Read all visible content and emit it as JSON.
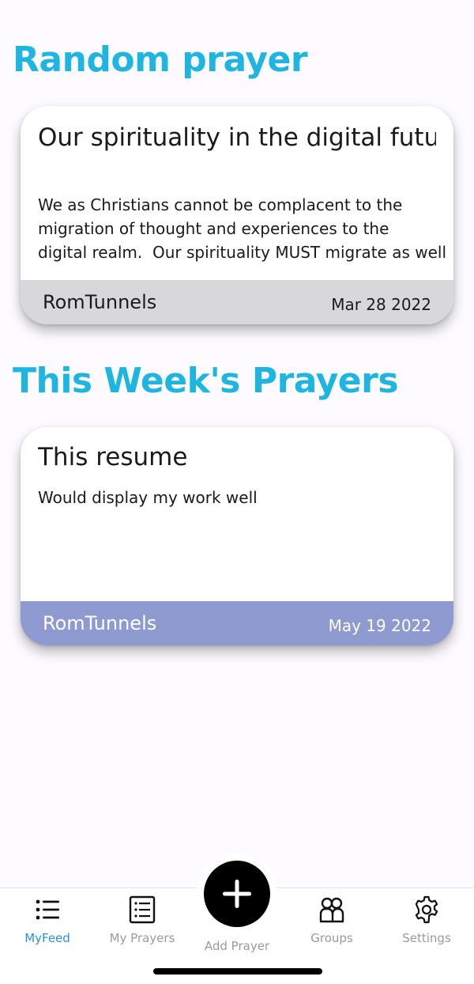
{
  "sections": {
    "random_title": "Random prayer",
    "week_title": "This Week's Prayers"
  },
  "random_card": {
    "title": "Our spirituality in the digital future",
    "body": "We as Christians cannot be complacent to the\nmigration of thought and experiences to the\ndigital realm.  Our spirituality MUST migrate as well",
    "author": "RomTunnels",
    "date": "Mar 28 2022",
    "footer_color": "#d8d8da"
  },
  "week_cards": [
    {
      "title": "This resume",
      "body": "Would display my work well",
      "author": "RomTunnels",
      "date": "May 19 2022",
      "footer_color": "#8e9ad0"
    }
  ],
  "nav": {
    "items": [
      {
        "label": "MyFeed",
        "icon": "list-icon",
        "active": true
      },
      {
        "label": "My Prayers",
        "icon": "document-list-icon",
        "active": false
      },
      {
        "label": "Add Prayer",
        "icon": "plus-icon",
        "active": false
      },
      {
        "label": "Groups",
        "icon": "group-icon",
        "active": false
      },
      {
        "label": "Settings",
        "icon": "gear-icon",
        "active": false
      }
    ]
  },
  "colors": {
    "accent": "#1eb6e0",
    "active_nav": "#2a8fde",
    "inactive_nav": "#9a9a9a"
  }
}
